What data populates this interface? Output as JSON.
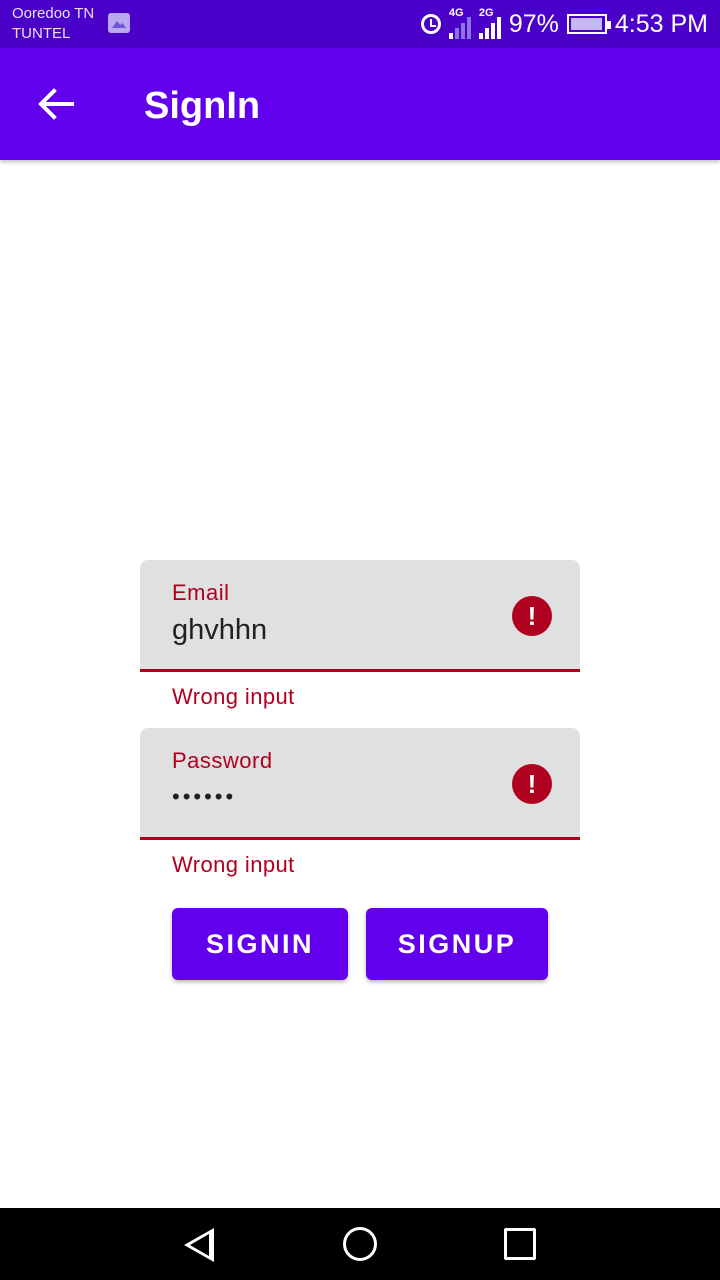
{
  "status_bar": {
    "carrier_line1": "Ooredoo TN",
    "carrier_line2": "TUNTEL",
    "net1": "4G",
    "net2": "2G",
    "battery": "97%",
    "time": "4:53 PM"
  },
  "app_bar": {
    "title": "SignIn"
  },
  "form": {
    "email_label": "Email",
    "email_value": "ghvhhn",
    "email_error": "Wrong input",
    "password_label": "Password",
    "password_value": "••••••",
    "password_error": "Wrong input"
  },
  "buttons": {
    "signin": "SIGNIN",
    "signup": "SIGNUP"
  },
  "colors": {
    "primary": "#6200ee",
    "status_bar": "#4a00c8",
    "error": "#b00020",
    "field_bg": "#e0e0e0"
  }
}
